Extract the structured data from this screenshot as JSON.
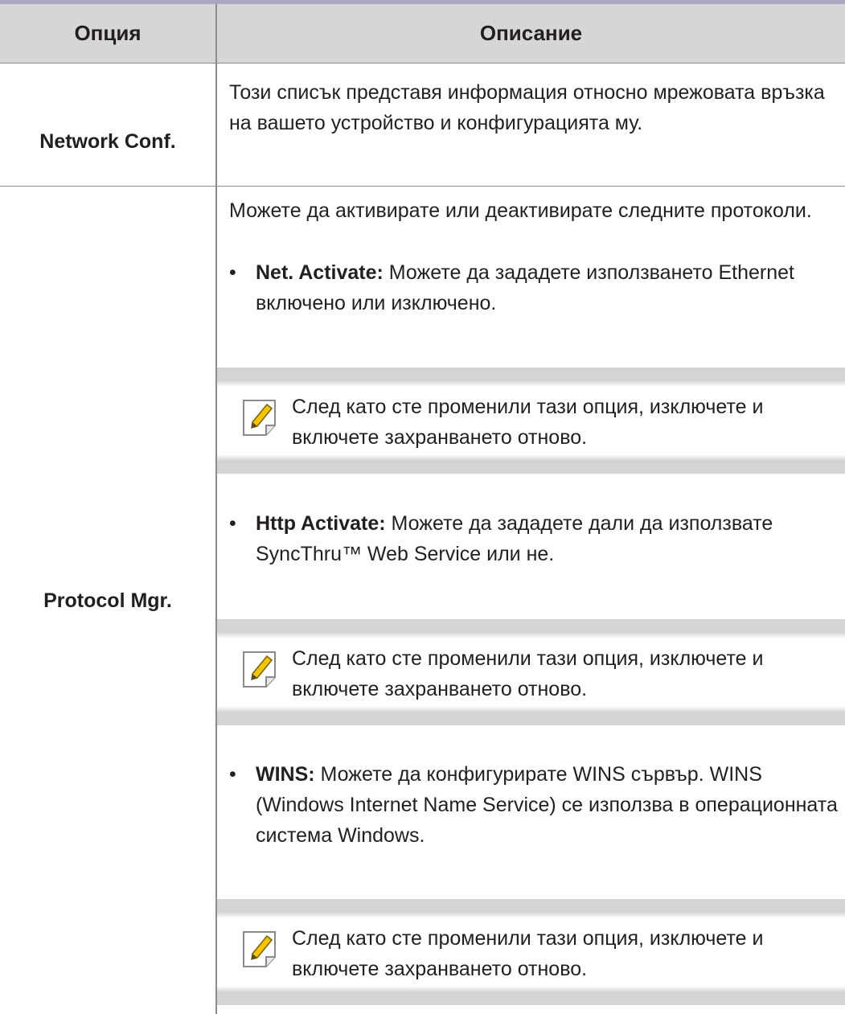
{
  "table": {
    "headers": {
      "option": "Опция",
      "description": "Описание"
    },
    "rows": [
      {
        "option": "Network Conf.",
        "description": "Този списък представя информация относно мрежовата връзка на вашето устройство и конфигурацията му."
      },
      {
        "option": "Protocol Mgr.",
        "intro": "Можете да активирате или деактивирате следните протоколи.",
        "items": [
          {
            "term": "Net. Activate:",
            "text": " Можете да зададете използването Ethernet включено или изключено.",
            "note": "След като сте променили тази опция, изключете и включете захранването отново."
          },
          {
            "term": "Http Activate:",
            "text": " Можете да зададете дали да използвате SyncThru™ Web Service или не.",
            "note": "След като сте променили тази опция, изключете и включете захранването отново."
          },
          {
            "term": "WINS:",
            "text": " Можете да конфигурирате WINS сървър. WINS (Windows Internet Name Service) се използва в операционната система Windows.",
            "note": "След като сте променили тази опция, изключете и включете захранването отново."
          }
        ]
      }
    ]
  },
  "icons": {
    "note": "note-pencil-icon"
  },
  "colors": {
    "header_bg": "#d6d6d6",
    "top_rule": "#a9a6c4",
    "note_band": "#d4d4d4",
    "pencil": "#f5c400"
  }
}
